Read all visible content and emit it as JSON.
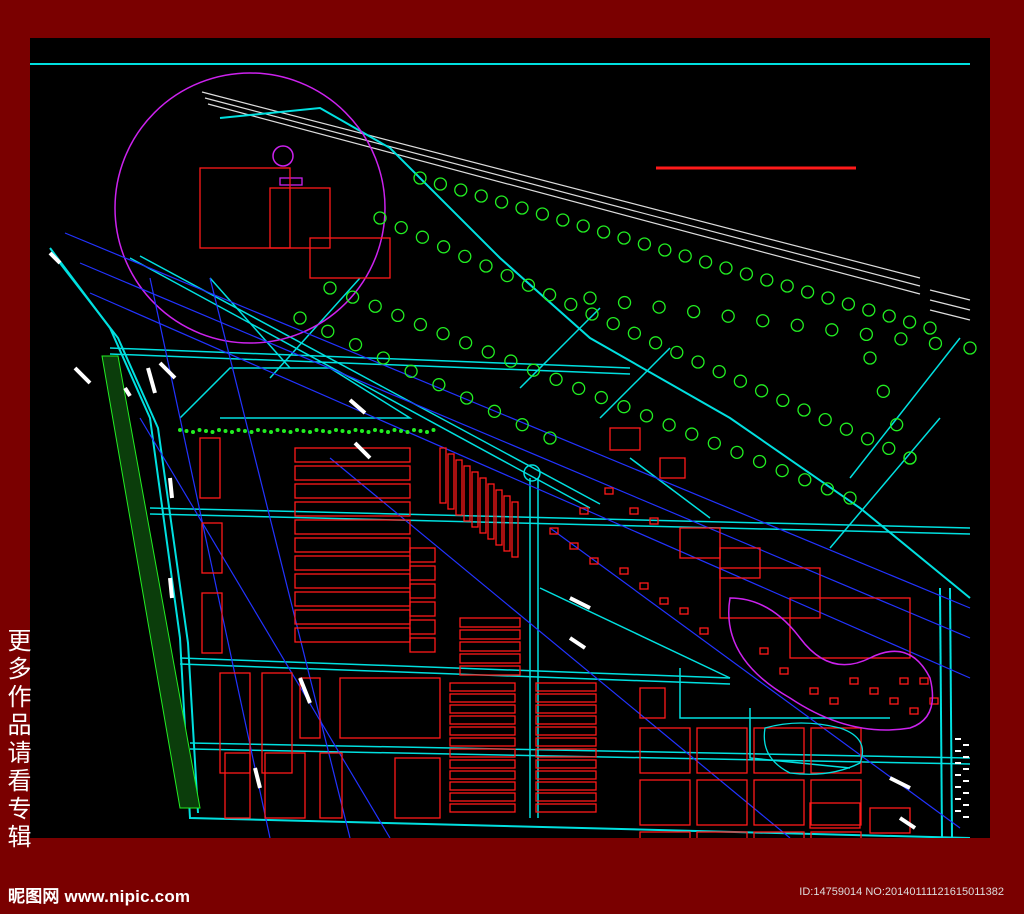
{
  "watermark": {
    "side_caption": "更多作品请看专辑",
    "site": "昵图网 www.nipic.com",
    "id_line": "ID:14759014 NO:20140111121615011382"
  },
  "colors": {
    "frame": "#7a0000",
    "background": "#000000",
    "road": "#00e0e0",
    "building": "#ff1a1a",
    "tree": "#22ee22",
    "grid_line": "#2233ff",
    "ring": "#cc22ee",
    "marker": "#ffffff"
  }
}
